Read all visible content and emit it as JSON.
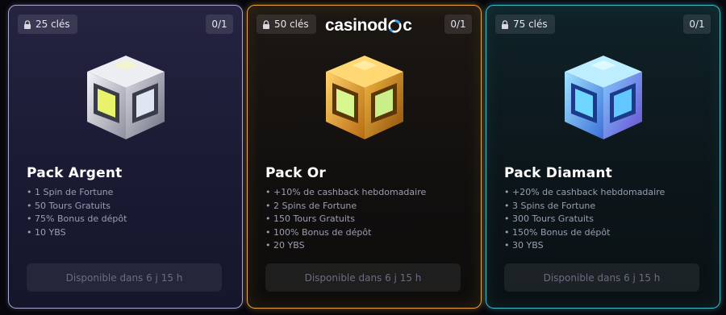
{
  "brand": {
    "name_prefix": "casinod",
    "name_suffix": "c"
  },
  "cards": [
    {
      "keys": "25 clés",
      "count": "0/1",
      "title": "Pack Argent",
      "features": [
        "1 Spin de Fortune",
        "50 Tours Gratuits",
        "75% Bonus de dépôt",
        "10 YBS"
      ],
      "button": "Disponible dans 6 j 15 h",
      "accent": "#a8a6cc",
      "icon": "silver-box-icon"
    },
    {
      "keys": "50 clés",
      "count": "0/1",
      "title": "Pack Or",
      "features": [
        "+10% de cashback hebdomadaire",
        "2 Spins de Fortune",
        "150 Tours Gratuits",
        "100% Bonus de dépôt",
        "20 YBS"
      ],
      "button": "Disponible dans 6 j 15 h",
      "accent": "#e9a43a",
      "icon": "gold-box-icon"
    },
    {
      "keys": "75 clés",
      "count": "0/1",
      "title": "Pack Diamant",
      "features": [
        "+20% de cashback hebdomadaire",
        "3 Spins de Fortune",
        "300 Tours Gratuits",
        "150% Bonus de dépôt",
        "30 YBS"
      ],
      "button": "Disponible dans 6 j 15 h",
      "accent": "#3fbfc9",
      "icon": "diamond-box-icon"
    }
  ]
}
